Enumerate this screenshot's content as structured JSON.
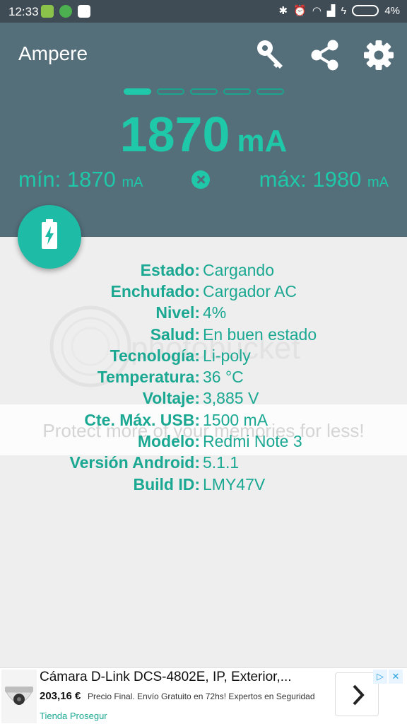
{
  "status_bar": {
    "time": "12:33",
    "battery": "4%"
  },
  "header": {
    "title": "Ampere"
  },
  "toolbar": {
    "icons": [
      "key-icon",
      "share-icon",
      "settings-icon"
    ]
  },
  "pager": {
    "total": 5,
    "active": 1
  },
  "reading": {
    "current_value": "1870",
    "current_unit": "mA",
    "min_label": "mín:",
    "min_value": "1870",
    "max_label": "máx:",
    "max_value": "1980",
    "unit": "mA"
  },
  "info": [
    {
      "label": "Estado:",
      "value": "Cargando"
    },
    {
      "label": "Enchufado:",
      "value": "Cargador AC"
    },
    {
      "label": "Nivel:",
      "value": "4%"
    },
    {
      "label": "Salud:",
      "value": "En buen estado"
    },
    {
      "label": "Tecnología:",
      "value": "Li-poly"
    },
    {
      "label": "Temperatura:",
      "value": "36 °C"
    },
    {
      "label": "Voltaje:",
      "value": "3,885 V"
    },
    {
      "label": "Cte. Máx. USB:",
      "value": "1500 mA"
    },
    {
      "label": "Modelo:",
      "value": "Redmi Note 3"
    },
    {
      "label": "Versión Android:",
      "value": "5.1.1"
    },
    {
      "label": "Build ID:",
      "value": "LMY47V"
    }
  ],
  "watermark": {
    "brand": "photobucket",
    "tagline": "Protect more of your memories for less!"
  },
  "ad": {
    "title": "Cámara D-Link DCS-4802E, IP, Exterior,...",
    "price": "203,16 €",
    "description": "Precio Final. Envío Gratuito en 72hs! Expertos en Seguridad",
    "store": "Tienda Prosegur"
  },
  "colors": {
    "accent": "#1ec8a8",
    "header": "#546e7a",
    "statusbar": "#3f4c55",
    "background": "#eeeeee"
  }
}
